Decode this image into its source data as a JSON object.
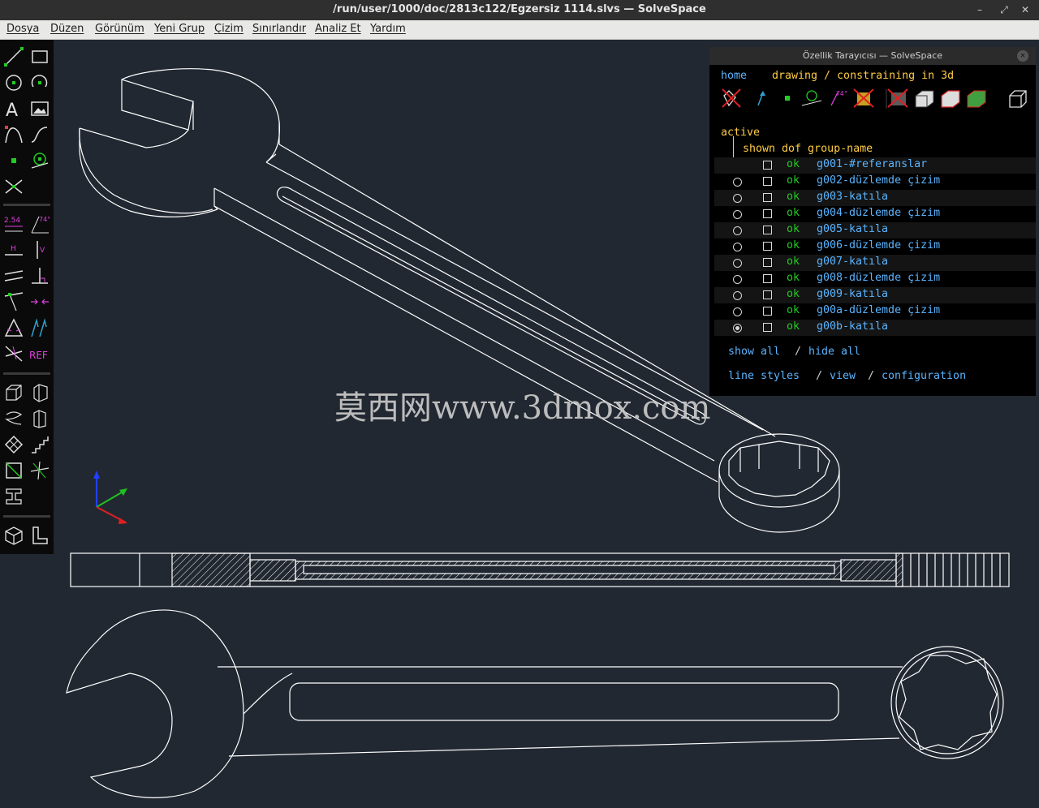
{
  "window": {
    "title": "/run/user/1000/doc/2813c122/Egzersiz 1114.slvs — SolveSpace",
    "controls": [
      "minimize",
      "maximize",
      "close"
    ]
  },
  "menu": [
    "Dosya",
    "Düzen",
    "Görünüm",
    "Yeni Grup",
    "Çizim",
    "Sınırlandır",
    "Analiz Et",
    "Yardım"
  ],
  "toolbar": {
    "groups": [
      [
        "line-icon",
        "rectangle-icon",
        "circle-icon",
        "arc-icon",
        "text-icon",
        "image-icon",
        "tangent-arc-icon",
        "cubic-spline-icon",
        "point-icon",
        "workplane-icon",
        "split-curves-icon"
      ],
      [
        "distance-constraint-icon",
        "angle-constraint-icon",
        "horizontal-constraint-icon",
        "vertical-constraint-icon",
        "parallel-constraint-icon",
        "perpendicular-constraint-icon",
        "point-on-line-constraint-icon",
        "symmetric-constraint-icon",
        "equal-constraint-icon",
        "other-supplementary-icon",
        "nearest-ortho-icon",
        "reference-constraint-icon"
      ],
      [
        "extrude-icon",
        "lathe-icon",
        "helix-icon",
        "revolve-icon",
        "step-translate-icon",
        "step-rotate-icon",
        "workplane-group-icon",
        "sketch-in-3d-icon",
        "link-assembly-icon"
      ],
      [
        "isometric-view-icon",
        "workplane-view-icon"
      ]
    ],
    "distance_label": "2.54",
    "angle_label": "74°",
    "horizontal_label": "H",
    "vertical_label": "V",
    "reference_label": "REF"
  },
  "browser": {
    "title": "Özellik Tarayıcısı — SolveSpace",
    "nav_home": "home",
    "nav_status": "drawing / constraining in 3d",
    "active_label": "active",
    "columns": "shown dof group-name",
    "groups": [
      {
        "name": "g001-#referanslar",
        "dof": "ok",
        "active": null
      },
      {
        "name": "g002-düzlemde çizim",
        "dof": "ok",
        "active": false
      },
      {
        "name": "g003-katıla",
        "dof": "ok",
        "active": false
      },
      {
        "name": "g004-düzlemde çizim",
        "dof": "ok",
        "active": false
      },
      {
        "name": "g005-katıla",
        "dof": "ok",
        "active": false
      },
      {
        "name": "g006-düzlemde çizim",
        "dof": "ok",
        "active": false
      },
      {
        "name": "g007-katıla",
        "dof": "ok",
        "active": false
      },
      {
        "name": "g008-düzlemde çizim",
        "dof": "ok",
        "active": false
      },
      {
        "name": "g009-katıla",
        "dof": "ok",
        "active": false
      },
      {
        "name": "g00a-düzlemde çizim",
        "dof": "ok",
        "active": false
      },
      {
        "name": "g00b-katıla",
        "dof": "ok",
        "active": true
      }
    ],
    "links_show": "show all",
    "links_sep": "/",
    "links_hide": "hide all",
    "footer_linestyles": "line styles",
    "footer_view": "view",
    "footer_config": "configuration"
  },
  "watermark": "莫西网www.3dmox.com",
  "colors": {
    "canvas_bg": "#222831",
    "toolbar_bg": "#0a0a0a",
    "panel_bg": "#000000",
    "link": "#5ab4ff",
    "ok": "#22cc22",
    "header_text": "#ffcc44",
    "sketch_line": "#ffffff",
    "axis_x": "#e02020",
    "axis_y": "#20c020",
    "axis_z": "#2040ff"
  }
}
